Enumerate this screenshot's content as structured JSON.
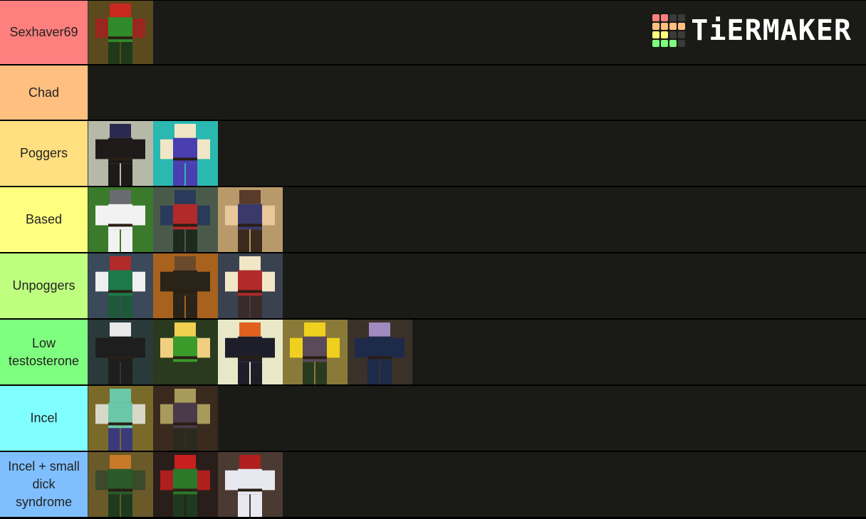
{
  "logo": {
    "text": "TiERMAKER",
    "grid_colors": [
      "#ff7f7f",
      "#ff7f7f",
      "#3a3a3a",
      "#3a3a3a",
      "#ffbf7f",
      "#ffbf7f",
      "#ffbf7f",
      "#ffbf7f",
      "#ffff7f",
      "#ffff7f",
      "#3a3a3a",
      "#3a3a3a",
      "#7fff7f",
      "#7fff7f",
      "#7fff7f",
      "#3a3a3a"
    ]
  },
  "tiers": [
    {
      "label": "Sexhaver69",
      "color": "#ff7f7f",
      "items": [
        {
          "name": "red-horned-green-tunic",
          "bg": "#5a4a1e",
          "skin": "#c8281e",
          "shirt": "#2f8a2a",
          "arms": "#9a2620",
          "pants": "#1e3a1a"
        }
      ]
    },
    {
      "label": "Chad",
      "color": "#ffbf7f",
      "items": []
    },
    {
      "label": "Poggers",
      "color": "#ffdf80",
      "items": [
        {
          "name": "dark-crouching-figure",
          "bg": "#b7b9a8",
          "skin": "#2a2a50",
          "shirt": "#1e1a1a",
          "arms": "#1e1a1a",
          "pants": "#1e1a1a"
        },
        {
          "name": "blue-hair-purple-tunic",
          "bg": "#2ab8b0",
          "skin": "#f1e7c6",
          "shirt": "#4a3fb0",
          "arms": "#f1e7c6",
          "pants": "#4a3fb0"
        }
      ]
    },
    {
      "label": "Based",
      "color": "#ffff7f",
      "items": [
        {
          "name": "white-blocky-figure",
          "bg": "#3a7a2a",
          "skin": "#6a6a72",
          "shirt": "#f2f2f2",
          "arms": "#f2f2f2",
          "pants": "#f2f2f2"
        },
        {
          "name": "white-hair-red-tunic",
          "bg": "#4a5a4a",
          "skin": "#2a3a5a",
          "shirt": "#b22a2a",
          "arms": "#2a3a5a",
          "pants": "#1e2a1e"
        },
        {
          "name": "brown-vest-figure",
          "bg": "#b89a6a",
          "skin": "#5a3a2a",
          "shirt": "#3a3a6a",
          "arms": "#e8c89a",
          "pants": "#3a2a1e"
        }
      ]
    },
    {
      "label": "Unpoggers",
      "color": "#bfff7f",
      "items": [
        {
          "name": "red-face-sword-figure",
          "bg": "#3a4a5a",
          "skin": "#b22a2a",
          "shirt": "#1e7a4a",
          "arms": "#f0f0f0",
          "pants": "#1e5a3a"
        },
        {
          "name": "dark-armor-figure",
          "bg": "#a8621e",
          "skin": "#6a4a2a",
          "shirt": "#2a2418",
          "arms": "#2a2418",
          "pants": "#2a2418"
        },
        {
          "name": "grey-hair-red-tunic",
          "bg": "#3a4250",
          "skin": "#f1e7c6",
          "shirt": "#b22a2a",
          "arms": "#f1e7c6",
          "pants": "#3a2a2a"
        }
      ]
    },
    {
      "label": "Low testosterone",
      "color": "#7fff7f",
      "items": [
        {
          "name": "white-hair-dark-coat",
          "bg": "#2a3a3a",
          "skin": "#e8e8e8",
          "shirt": "#1e1e1e",
          "arms": "#1e1e1e",
          "pants": "#1e1e1e"
        },
        {
          "name": "yellow-green-tunic",
          "bg": "#2a3a1e",
          "skin": "#f0d050",
          "shirt": "#3a9a2a",
          "arms": "#f0d080",
          "pants": "#2a3a1e"
        },
        {
          "name": "pumpkin-head-figure",
          "bg": "#e8e8c8",
          "skin": "#e0601e",
          "shirt": "#1e1e2a",
          "arms": "#1e1e2a",
          "pants": "#1e1e2a"
        },
        {
          "name": "brown-hair-yellow-figure",
          "bg": "#8a7a3a",
          "skin": "#f0d01e",
          "shirt": "#5a4a5a",
          "arms": "#f0d01e",
          "pants": "#2a3a1e"
        },
        {
          "name": "purple-face-navy-coat",
          "bg": "#3a3228",
          "skin": "#a08ac0",
          "shirt": "#1e2a4a",
          "arms": "#1e2a4a",
          "pants": "#1e2a4a"
        }
      ]
    },
    {
      "label": "Incel",
      "color": "#7fffff",
      "items": [
        {
          "name": "teal-spiky-hair-figure",
          "bg": "#7a6a2a",
          "skin": "#6ac8a8",
          "shirt": "#6ac8a8",
          "arms": "#d8d8c8",
          "pants": "#3a3a7a"
        },
        {
          "name": "olive-purple-tunic",
          "bg": "#3a2a1e",
          "skin": "#a89a5a",
          "shirt": "#4a3a4a",
          "arms": "#a89a5a",
          "pants": "#2a2a1e"
        }
      ]
    },
    {
      "label": "Incel + small dick syndrome",
      "color": "#7fbfff",
      "items": [
        {
          "name": "red-hair-green-jacket",
          "bg": "#6a5a2a",
          "skin": "#c87a2a",
          "shirt": "#2a5a2a",
          "arms": "#3a4a2a",
          "pants": "#1e3a1e"
        },
        {
          "name": "red-horned-green-tunic-2",
          "bg": "#2a1e1a",
          "skin": "#c8201e",
          "shirt": "#2a7a2a",
          "arms": "#b01e1e",
          "pants": "#1e3a1e"
        },
        {
          "name": "mushroom-hat-white-figure",
          "bg": "#4a3a32",
          "skin": "#b01e1e",
          "shirt": "#e8e8f0",
          "arms": "#e8e8f0",
          "pants": "#e8e8f0"
        }
      ]
    }
  ]
}
